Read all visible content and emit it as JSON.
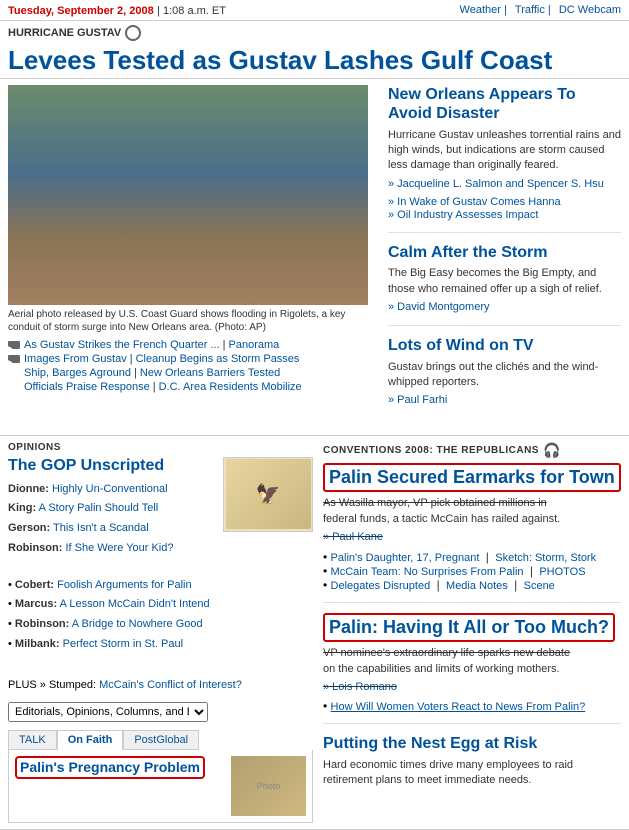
{
  "topbar": {
    "date": "Tuesday, September 2, 2008",
    "time": "1:08 a.m. ET",
    "links": [
      "Weather",
      "Traffic",
      "DC Webcam"
    ]
  },
  "header": {
    "hurricane_label": "HURRICANE GUSTAV",
    "main_headline": "Levees Tested as Gustav Lashes Gulf Coast"
  },
  "main_image": {
    "caption": "Aerial photo released by U.S. Coast Guard shows flooding in Rigolets, a key conduit of storm surge into New Orleans area. (Photo: AP)"
  },
  "small_links": [
    {
      "icon": true,
      "links": [
        {
          "text": "As Gustav Strikes the French Quarter ...",
          "href": "#"
        },
        {
          "text": "Panorama",
          "href": "#"
        }
      ]
    },
    {
      "icon": true,
      "links": [
        {
          "text": "Images From Gustav",
          "href": "#"
        },
        {
          "text": "Cleanup Begins as Storm Passes",
          "href": "#"
        }
      ]
    },
    {
      "icon": false,
      "links": [
        {
          "text": "Ship, Barges Aground",
          "href": "#"
        },
        {
          "text": "New Orleans Barriers Tested",
          "href": "#"
        }
      ]
    },
    {
      "icon": false,
      "links": [
        {
          "text": "Officials Praise Response",
          "href": "#"
        },
        {
          "text": "D.C. Area Residents Mobilize",
          "href": "#"
        }
      ]
    }
  ],
  "right_stories": [
    {
      "id": "new-orleans",
      "headline": "New Orleans Appears To Avoid Disaster",
      "body": "Hurricane Gustav unleashes torrential rains and high winds, but indications are storm caused less damage than originally feared.",
      "byline": "» Jacqueline L. Salmon and Spencer S. Hsu",
      "sub_links": [
        "» In Wake of Gustav Comes Hanna",
        "» Oil Industry Assesses Impact"
      ]
    },
    {
      "id": "calm",
      "headline": "Calm After the Storm",
      "body": "The Big Easy becomes the Big Empty, and those who remained offer up a sigh of relief.",
      "byline": "» David Montgomery",
      "sub_links": []
    },
    {
      "id": "wind",
      "headline": "Lots of Wind on TV",
      "body": "Gustav brings out the clichés and the wind-whipped reporters.",
      "byline": "» Paul Farhi",
      "sub_links": []
    }
  ],
  "opinions": {
    "section_label": "OPINIONS",
    "title": "The GOP Unscripted",
    "items": [
      {
        "author": "Dionne:",
        "link_text": "Highly Un-Conventional"
      },
      {
        "author": "King:",
        "link_text": "A Story Palin Should Tell"
      },
      {
        "author": "Gerson:",
        "link_text": "This Isn't a Scandal"
      },
      {
        "author": "Robinson:",
        "link_text": "If She Were Your Kid?"
      }
    ],
    "bullet_items": [
      {
        "link_text": "Foolish Arguments for Palin"
      },
      {
        "link_text": "A Lesson McCain Didn't Intend"
      },
      {
        "link_text": "A Bridge to Nowhere Good"
      },
      {
        "link_text": "Perfect Storm in St. Paul"
      }
    ],
    "bullet_authors": [
      "Cobert:",
      "Marcus:",
      "Robinson:",
      "Milbank:"
    ],
    "plus": "PLUS » Stumped:",
    "plus_link": "McCain's Conflict of Interest?",
    "dropdown_label": "Editorials, Opinions, Columns, and Blogs"
  },
  "talk": {
    "tabs": [
      "TALK",
      "On Faith",
      "PostGlobal"
    ],
    "active_tab": "TALK",
    "headline": "Palin's Pregnancy Problem"
  },
  "conventions": {
    "label": "CONVENTIONS 2008: THE REPUBLICANS",
    "stories": [
      {
        "id": "earmarks",
        "headline": "Palin Secured Earmarks for Town",
        "body": "As Wasilla mayor, VP pick obtained millions in federal funds, a tactic McCain has railed against.",
        "byline": "» Paul Kane",
        "sub_links": [
          "» Palin's Daughter, 17, Pregnant | Sketch: Storm, Stork",
          "» McCain Team: No Surprises From Palin | PHOTOS",
          "» Delegates Disrupted | Media Notes | Scene"
        ]
      },
      {
        "id": "having-it-all",
        "headline": "Palin: Having It All or Too Much?",
        "body": "VP nominee's extraordinary life sparks new debate on the capabilities and limits of working mothers.",
        "byline": "» Lois Romano",
        "sub_links": [
          "» How Will Women Voters React to News From Palin?"
        ]
      }
    ]
  },
  "nest_egg": {
    "headline": "Putting the Nest Egg at Risk",
    "body": "Hard economic times drive many employees to raid retirement plans to meet immediate needs."
  }
}
